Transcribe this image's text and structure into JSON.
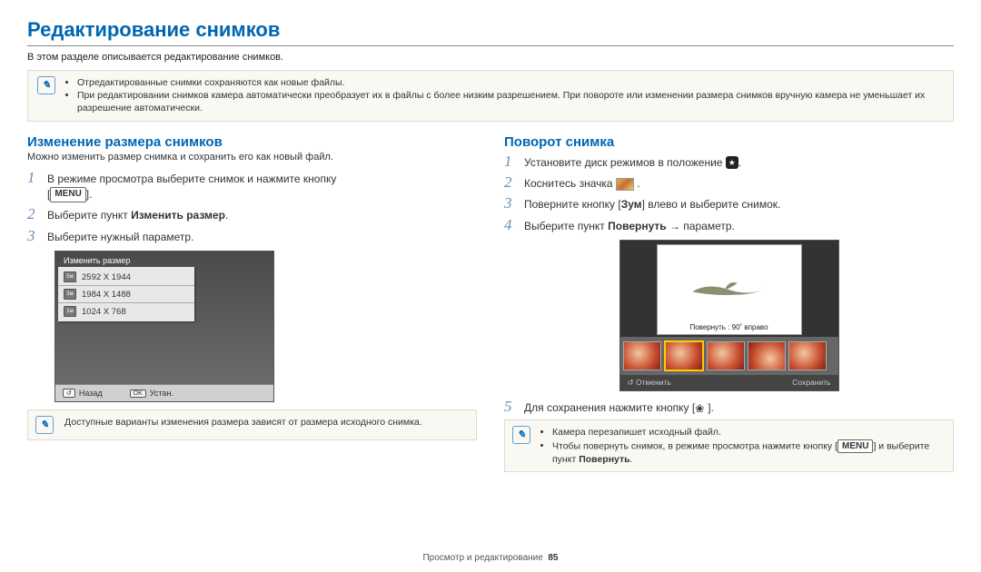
{
  "title": "Редактирование снимков",
  "intro": "В этом разделе описывается редактирование снимков.",
  "top_note": {
    "items": [
      "Отредактированные снимки сохраняются как новые файлы.",
      "При редактировании снимков камера автоматически преобразует их в файлы с более низким разрешением. При повороте или изменении размера снимков вручную камера не уменьшает их разрешение автоматически."
    ]
  },
  "left": {
    "heading": "Изменение размера снимков",
    "subintro": "Можно изменить размер снимка и сохранить его как новый файл.",
    "step1": "В режиме просмотра выберите снимок и нажмите кнопку",
    "step1_menu": "[",
    "step1_menu_label": "MENU",
    "step1_end": "].",
    "step2_a": "Выберите пункт ",
    "step2_b": "Изменить размер",
    "step2_c": ".",
    "step3": "Выберите нужный параметр.",
    "screenshot": {
      "header": "Изменить размер",
      "sizes": [
        "2592 X 1944",
        "1984 X 1488",
        "1024 X 768"
      ],
      "back_label": "Назад",
      "ok_label": "Устан.",
      "back_icon": "↺",
      "ok_icon": "OK"
    },
    "note": "Доступные варианты изменения размера зависят от размера исходного снимка."
  },
  "right": {
    "heading": "Поворот снимка",
    "step1_a": "Установите диск режимов в положение ",
    "step1_b": ".",
    "step2_a": "Коснитесь значка ",
    "step2_b": " .",
    "step3_a": "Поверните кнопку [",
    "step3_b": "Зум",
    "step3_c": "] влево и выберите снимок.",
    "step4_a": "Выберите пункт ",
    "step4_b": "Повернуть",
    "step4_c": " → параметр.",
    "screenshot": {
      "rotate_caption": "Повернуть : 90˚ вправо",
      "cancel": "Отменить",
      "save": "Сохранить",
      "cancel_icon": "↺"
    },
    "step5_a": "Для сохранения нажмите кнопку [",
    "step5_b": "].",
    "note": {
      "items": [
        "Камера перезапишет исходный файл.",
        {
          "pre": "Чтобы повернуть снимок, в режиме просмотра нажмите кнопку [",
          "menu": "MENU",
          "mid": "] и выберите пункт ",
          "bold": "Повернуть",
          "post": "."
        }
      ]
    }
  },
  "footer": {
    "section": "Просмотр и редактирование",
    "page": "85"
  }
}
